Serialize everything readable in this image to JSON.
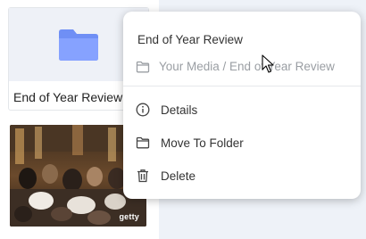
{
  "folder_card": {
    "title": "End of Year Review",
    "icon": "folder-icon",
    "icon_color": "#7b9bff"
  },
  "image_card": {
    "watermark": "getty"
  },
  "context_menu": {
    "title": "End of Year Review",
    "path": "Your Media / End of Year Review",
    "items": [
      {
        "label": "Details",
        "icon": "info-icon"
      },
      {
        "label": "Move To Folder",
        "icon": "folder-outline-icon"
      },
      {
        "label": "Delete",
        "icon": "trash-icon"
      }
    ]
  },
  "colors": {
    "accent": "#7b9bff",
    "right_background": "#eef2f8"
  }
}
